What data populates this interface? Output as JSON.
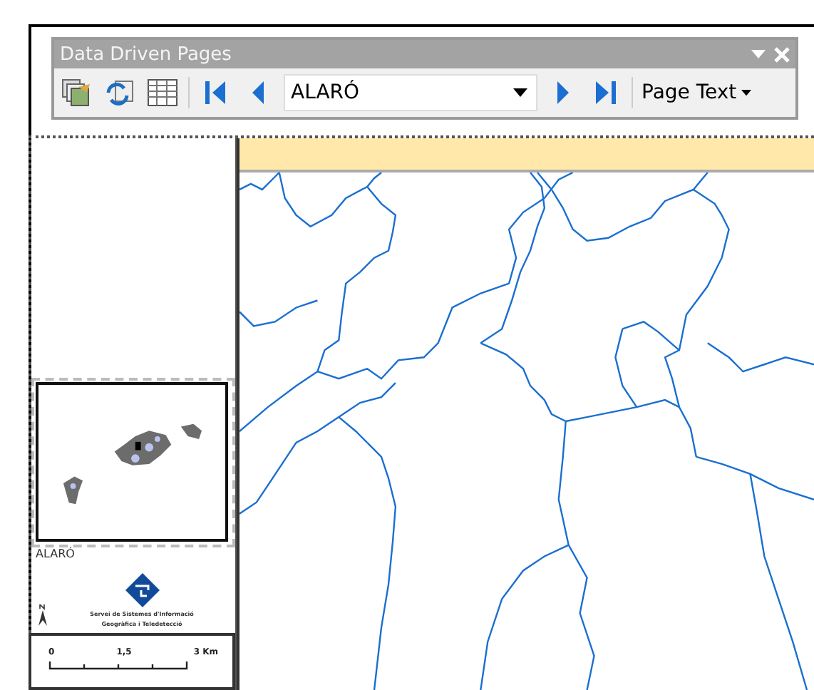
{
  "toolbar": {
    "title": "Data Driven Pages",
    "page_select": {
      "value": "ALARÓ"
    },
    "page_text_menu": "Page Text"
  },
  "layout": {
    "locator_label": "ALARÓ",
    "logo_lines": [
      "Servei de Sistemes d'Informació",
      "Geogràfica i Teledetecció"
    ],
    "scale_labels": [
      "0",
      "1,5",
      "3 Km"
    ]
  }
}
